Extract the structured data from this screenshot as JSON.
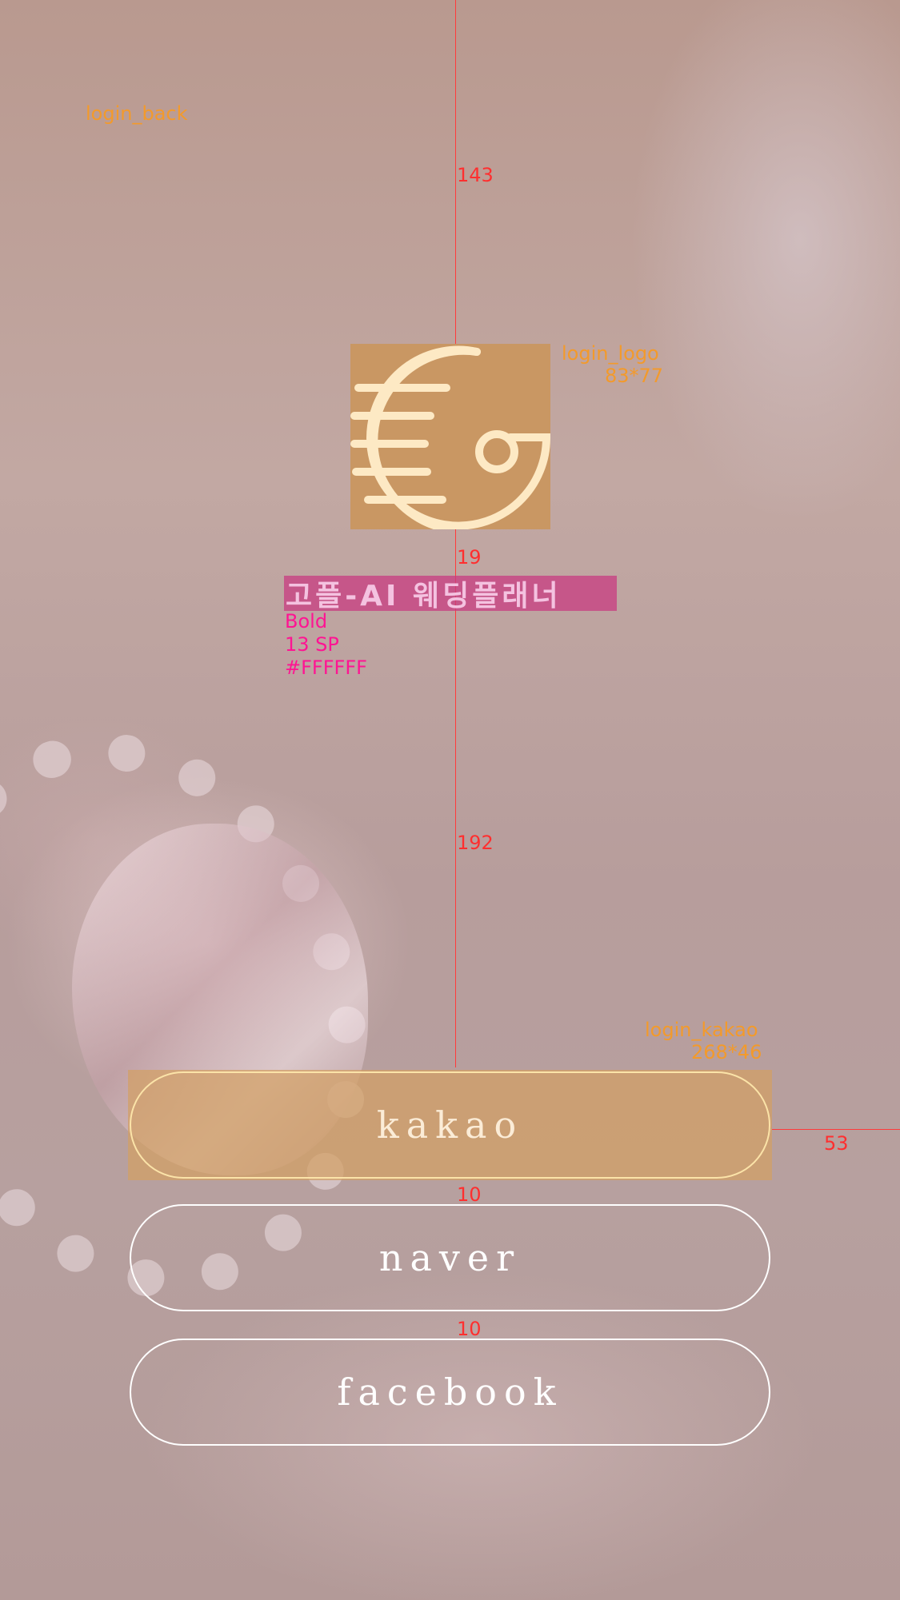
{
  "annotations": {
    "background_label": "login_back",
    "logo_label": "login_logo",
    "logo_size": "83*77",
    "title_font_weight": "Bold",
    "title_font_size": "13 SP",
    "title_color": "#FFFFFF",
    "kakao_label": "login_kakao",
    "kakao_size": "268*46",
    "spacing_top": "143",
    "spacing_logo_title": "19",
    "spacing_title_buttons": "192",
    "spacing_kakao_naver": "10",
    "spacing_naver_facebook": "10",
    "spacing_right": "53"
  },
  "app": {
    "title": "고플-AI 웨딩플래너"
  },
  "buttons": {
    "kakao": "kakao",
    "naver": "naver",
    "facebook": "facebook"
  },
  "colors": {
    "logo_bg": "#c99763",
    "logo_stroke": "#fde9c4",
    "annotation_orange": "#f39a2b",
    "annotation_pink": "#ff1493",
    "guide_red": "#ff2f2f"
  }
}
